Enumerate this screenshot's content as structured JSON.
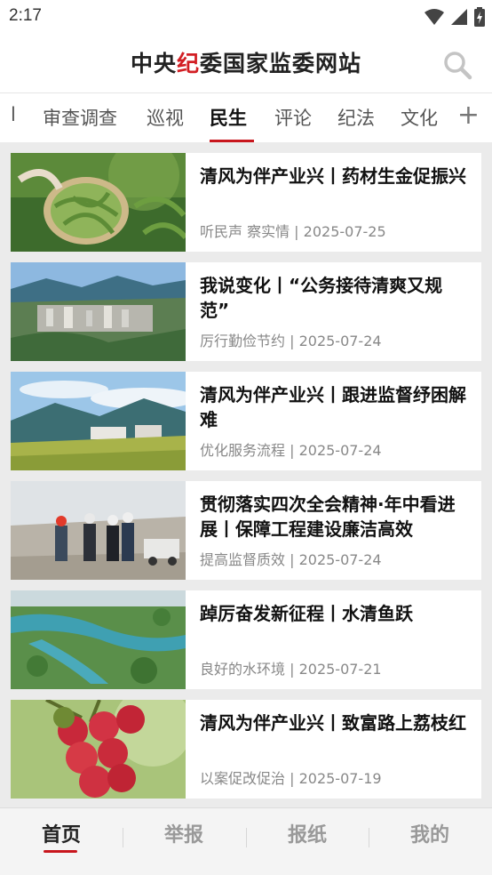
{
  "status_bar": {
    "time": "2:17"
  },
  "header": {
    "title_part1": "中央",
    "title_accent": "纪",
    "title_part2": "委国家监委网站",
    "accent_color": "#d21f24"
  },
  "tabs": [
    {
      "label": "l"
    },
    {
      "label": "审查调查"
    },
    {
      "label": "巡视"
    },
    {
      "label": "民生",
      "active": true
    },
    {
      "label": "评论"
    },
    {
      "label": "纪法"
    },
    {
      "label": "文化"
    }
  ],
  "tab_plus": "+",
  "news": [
    {
      "title": "清风为伴产业兴丨药材生金促振兴",
      "source": "听民声 察实情",
      "date": "2025-07-25",
      "thumb": "herbs-photo"
    },
    {
      "title": "我说变化丨“公务接待清爽又规范”",
      "source": "厉行勤俭节约",
      "date": "2025-07-24",
      "thumb": "city-valley-photo"
    },
    {
      "title": "清风为伴产业兴丨跟进监督纾困解难",
      "source": "优化服务流程",
      "date": "2025-07-24",
      "thumb": "mountain-village-photo"
    },
    {
      "title": "贯彻落实四次全会精神·年中看进展丨保障工程建设廉洁高效",
      "source": "提高监督质效",
      "date": "2025-07-24",
      "thumb": "construction-site-photo"
    },
    {
      "title": " 踔厉奋发新征程丨水清鱼跃",
      "source": "良好的水环境",
      "date": "2025-07-21",
      "thumb": "river-aerial-photo"
    },
    {
      "title": "清风为伴产业兴丨致富路上荔枝红",
      "source": "以案促改促治",
      "date": "2025-07-19",
      "thumb": "lychee-photo"
    }
  ],
  "meta_separator": " | ",
  "bottom_nav": [
    {
      "label": "首页",
      "active": true
    },
    {
      "label": "举报"
    },
    {
      "label": "报纸"
    },
    {
      "label": "我的"
    }
  ],
  "icons": {
    "search": "search-icon",
    "wifi": "wifi-icon",
    "signal": "signal-icon",
    "battery": "battery-icon"
  },
  "colors": {
    "brand_red": "#c8161d"
  }
}
